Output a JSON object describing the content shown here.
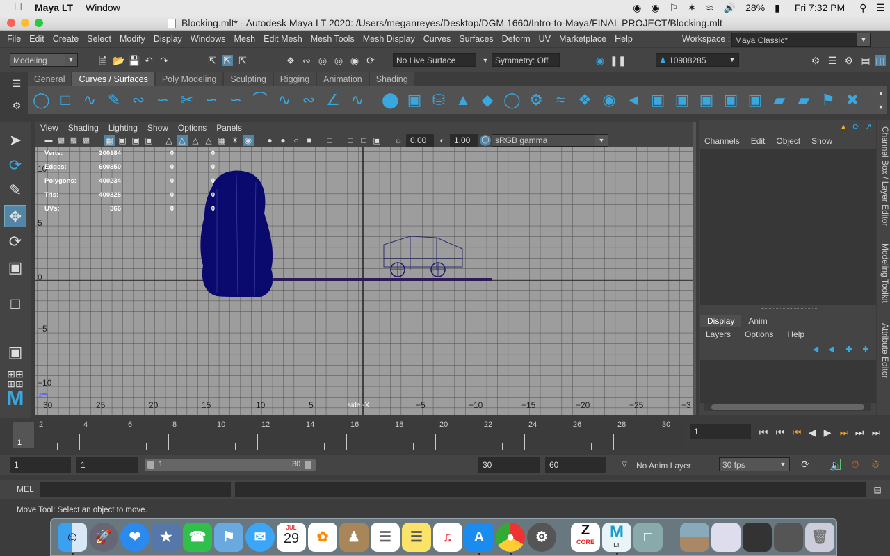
{
  "mac_menubar": {
    "apple": "",
    "app_name": "Maya LT",
    "window_menu": "Window",
    "battery": "28%",
    "clock": "Fri 7:32 PM"
  },
  "window": {
    "title": "Blocking.mlt* - Autodesk Maya LT 2020: /Users/meganreyes/Desktop/DGM 1660/Intro-to-Maya/FINAL PROJECT/Blocking.mlt"
  },
  "menu": {
    "items": [
      "File",
      "Edit",
      "Create",
      "Select",
      "Modify",
      "Display",
      "Windows",
      "Mesh",
      "Edit Mesh",
      "Mesh Tools",
      "Mesh Display",
      "Curves",
      "Surfaces",
      "Deform",
      "UV",
      "Marketplace",
      "Help"
    ],
    "workspace_label": "Workspace :",
    "workspace_value": "Maya Classic*"
  },
  "status_line": {
    "menu_set": "Modeling",
    "live_surface": "No Live Surface",
    "symmetry": "Symmetry: Off",
    "user_id": "10908285"
  },
  "shelf": {
    "tabs": [
      "General",
      "Curves / Surfaces",
      "Poly Modeling",
      "Sculpting",
      "Rigging",
      "Animation",
      "Shading"
    ],
    "active_tab": "Curves / Surfaces"
  },
  "viewport": {
    "menu": [
      "View",
      "Shading",
      "Lighting",
      "Show",
      "Options",
      "Panels"
    ],
    "exposure": "0.00",
    "gamma": "1.00",
    "color_space": "sRGB gamma",
    "camera_label": "side -X",
    "hud": [
      {
        "label": "Verts:",
        "total": "200184",
        "selected": "0",
        "extra": "0"
      },
      {
        "label": "Edges:",
        "total": "600350",
        "selected": "0",
        "extra": "0"
      },
      {
        "label": "Polygons:",
        "total": "400234",
        "selected": "0",
        "extra": "0"
      },
      {
        "label": "Tris:",
        "total": "400328",
        "selected": "0",
        "extra": "0"
      },
      {
        "label": "UVs:",
        "total": "366",
        "selected": "0",
        "extra": "0"
      }
    ],
    "grid_x_labels": [
      "30",
      "25",
      "20",
      "15",
      "10",
      "5",
      "−5",
      "−10",
      "−15",
      "−20",
      "−25",
      "−3"
    ],
    "grid_y_labels": [
      "10",
      "5",
      "0",
      "−5",
      "−10"
    ]
  },
  "channel_box": {
    "menu": [
      "Channels",
      "Edit",
      "Object",
      "Show"
    ],
    "layer_tabs": [
      "Display",
      "Anim"
    ],
    "layer_menu": [
      "Layers",
      "Options",
      "Help"
    ],
    "side_tabs": [
      "Channel Box / Layer Editor",
      "Modeling Toolkit",
      "Attribute Editor"
    ]
  },
  "timeline": {
    "frame_labels": [
      "2",
      "4",
      "6",
      "8",
      "10",
      "12",
      "14",
      "16",
      "18",
      "20",
      "22",
      "24",
      "26",
      "28",
      "30"
    ],
    "current_frame_marker": "1",
    "current_frame": "1"
  },
  "range": {
    "start": "1",
    "playback_start": "1",
    "slider_start": "1",
    "slider_end": "30",
    "playback_end": "30",
    "end": "60",
    "anim_layer": "No Anim Layer",
    "fps": "30 fps"
  },
  "command_line": {
    "label": "MEL"
  },
  "help_line": {
    "text": "Move Tool: Select an object to move."
  },
  "dock": {
    "calendar_month": "JUL",
    "calendar_day": "29",
    "core_label": "CORE",
    "lt_label": "LT"
  },
  "colors": {
    "maya_bg": "#444444",
    "viewport_bg": "#9d9d9d",
    "mesh_blue": "#0a0a6e",
    "accent_blue": "#39a8e0"
  }
}
